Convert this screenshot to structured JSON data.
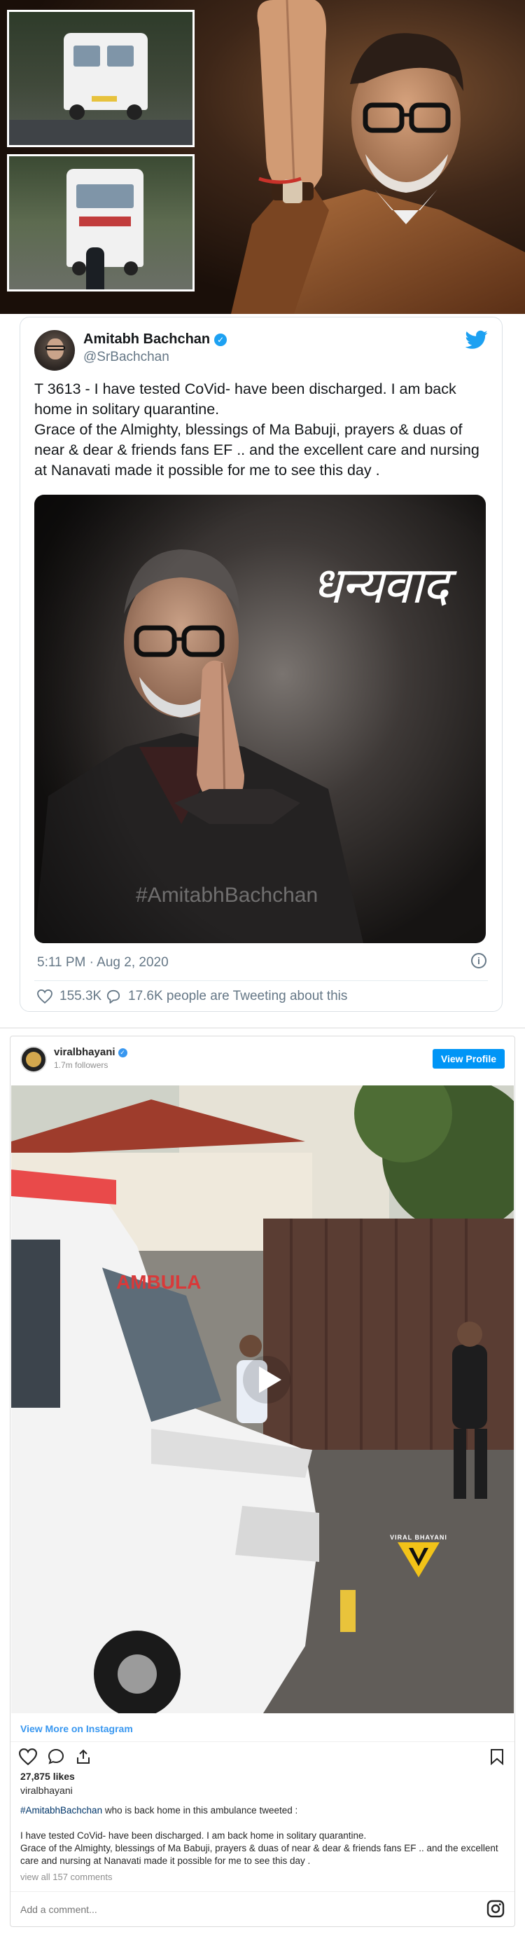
{
  "tweet": {
    "name": "Amitabh Bachchan",
    "handle": "@SrBachchan",
    "text_lines": [
      "T 3613 - I have tested CoVid- have been discharged. I am back home in solitary quarantine.",
      "Grace of the Almighty, blessings of Ma Babuji, prayers & duas of near & dear & friends fans EF .. and the excellent care and nursing at Nanavati made it possible for me to see this day ."
    ],
    "media_script_text": "धन्यवाद",
    "media_hashtag": "#AmitabhBachchan",
    "timestamp": "5:11 PM · Aug 2, 2020",
    "likes": "155.3K",
    "retweet_talk": "17.6K people are Tweeting about this",
    "brand_color": "#1da1f2"
  },
  "instagram": {
    "username": "viralbhayani",
    "followers": "1.7m followers",
    "view_profile_label": "View Profile",
    "watermark": "VIRAL BHAYANI",
    "view_more_label": "View More on Instagram",
    "likes": "27,875 likes",
    "owner": "viralbhayani",
    "caption_hashtag": "#AmitabhBachchan",
    "caption_first": " who is back home in this ambulance tweeted :",
    "caption_body_lines": [
      "I have tested CoVid- have been discharged. I am back home in solitary quarantine.",
      "Grace of the Almighty, blessings of Ma Babuji, prayers & duas of near & dear & friends fans EF .. and the excellent care and nursing at Nanavati made it possible for me to see this day ."
    ],
    "view_comments": "view all 157 comments",
    "add_comment_placeholder": "Add a comment...",
    "accent_color": "#0095f6"
  }
}
